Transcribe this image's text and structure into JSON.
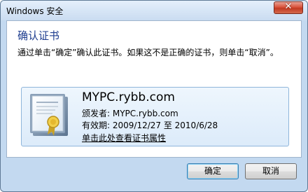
{
  "window": {
    "title": "Windows 安全",
    "close_glyph": "✕"
  },
  "dialog": {
    "heading": "确认证书",
    "instruction": "通过单击“确定”确认此证书。如果这不是正确的证书，则单击“取消”。"
  },
  "certificate": {
    "icon": "certificate-icon",
    "name": "MYPC.rybb.com",
    "issuer_label": "颁发者: MYPC.rybb.com",
    "validity_label": "有效期: 2009/12/27 至 2010/6/28",
    "properties_link": "单击此处查看证书属性"
  },
  "buttons": {
    "ok_label": "确定",
    "cancel_label": "取消"
  },
  "colors": {
    "heading": "#1e3d8f",
    "close_button": "#c23a22",
    "cert_box_border": "#8fb6db"
  }
}
